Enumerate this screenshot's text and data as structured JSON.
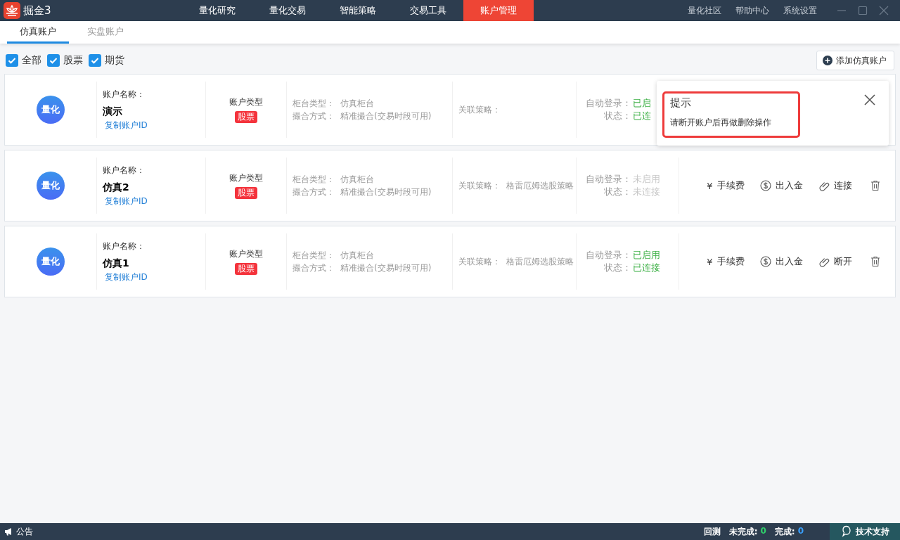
{
  "app": {
    "logo_text": "掘金3"
  },
  "nav": [
    {
      "label": "量化研究",
      "selected": false
    },
    {
      "label": "量化交易",
      "selected": false
    },
    {
      "label": "智能策略",
      "selected": false
    },
    {
      "label": "交易工具",
      "selected": false
    },
    {
      "label": "账户管理",
      "selected": true
    }
  ],
  "top_links": [
    "量化社区",
    "帮助中心",
    "系统设置"
  ],
  "tabs": [
    {
      "label": "仿真账户",
      "selected": true
    },
    {
      "label": "实盘账户",
      "selected": false
    }
  ],
  "filters": [
    {
      "label": "全部",
      "checked": true
    },
    {
      "label": "股票",
      "checked": true
    },
    {
      "label": "期货",
      "checked": true
    }
  ],
  "add_button": "添加仿真账户",
  "accounts": [
    {
      "avatar": "量化",
      "name_label": "账户名称：",
      "name": "演示",
      "copy_link": "复制账户ID",
      "type_label": "账户类型",
      "type_tag": "股票",
      "counter_label": "柜台类型：",
      "counter": "仿真柜台",
      "match_label": "撮合方式：",
      "match": "精准撮合(交易时段可用)",
      "strategy_label": "关联策略：",
      "auto_label": "自动登录：",
      "auto_value": "已启",
      "auto_enabled": true,
      "state_label": "状态：",
      "state_value": "已连",
      "connected": true
    },
    {
      "avatar": "量化",
      "name_label": "账户名称：",
      "name": "仿真2",
      "copy_link": "复制账户ID",
      "type_label": "账户类型",
      "type_tag": "股票",
      "counter_label": "柜台类型：",
      "counter": "仿真柜台",
      "match_label": "撮合方式：",
      "match": "精准撮合(交易时段可用)",
      "strategy_label": "关联策略：",
      "strategy": "格雷厄姆选股策略",
      "auto_label": "自动登录：",
      "auto_value": "未启用",
      "auto_enabled": false,
      "state_label": "状态：",
      "state_value": "未连接",
      "connected": false,
      "actions": [
        {
          "kind": "fee",
          "icon": "¥",
          "label": "手续费"
        },
        {
          "kind": "funds",
          "label": "出入金"
        },
        {
          "kind": "link",
          "label": "连接"
        },
        {
          "kind": "delete"
        }
      ]
    },
    {
      "avatar": "量化",
      "name_label": "账户名称：",
      "name": "仿真1",
      "copy_link": "复制账户ID",
      "type_label": "账户类型",
      "type_tag": "股票",
      "counter_label": "柜台类型：",
      "counter": "仿真柜台",
      "match_label": "撮合方式：",
      "match": "精准撮合(交易时段可用)",
      "strategy_label": "关联策略：",
      "strategy": "格雷厄姆选股策略",
      "auto_label": "自动登录：",
      "auto_value": "已启用",
      "auto_enabled": true,
      "state_label": "状态：",
      "state_value": "已连接",
      "connected": true,
      "actions": [
        {
          "kind": "fee",
          "icon": "¥",
          "label": "手续费"
        },
        {
          "kind": "funds",
          "label": "出入金"
        },
        {
          "kind": "link",
          "label": "断开"
        },
        {
          "kind": "delete"
        }
      ]
    }
  ],
  "popup": {
    "title": "提示",
    "message": "请断开账户后再做删除操作"
  },
  "status_bar": {
    "notice": "公告",
    "backtest": "回测",
    "pending_label": "未完成:",
    "pending": "0",
    "done_label": "完成:",
    "done": "0",
    "support": "技术支持"
  }
}
